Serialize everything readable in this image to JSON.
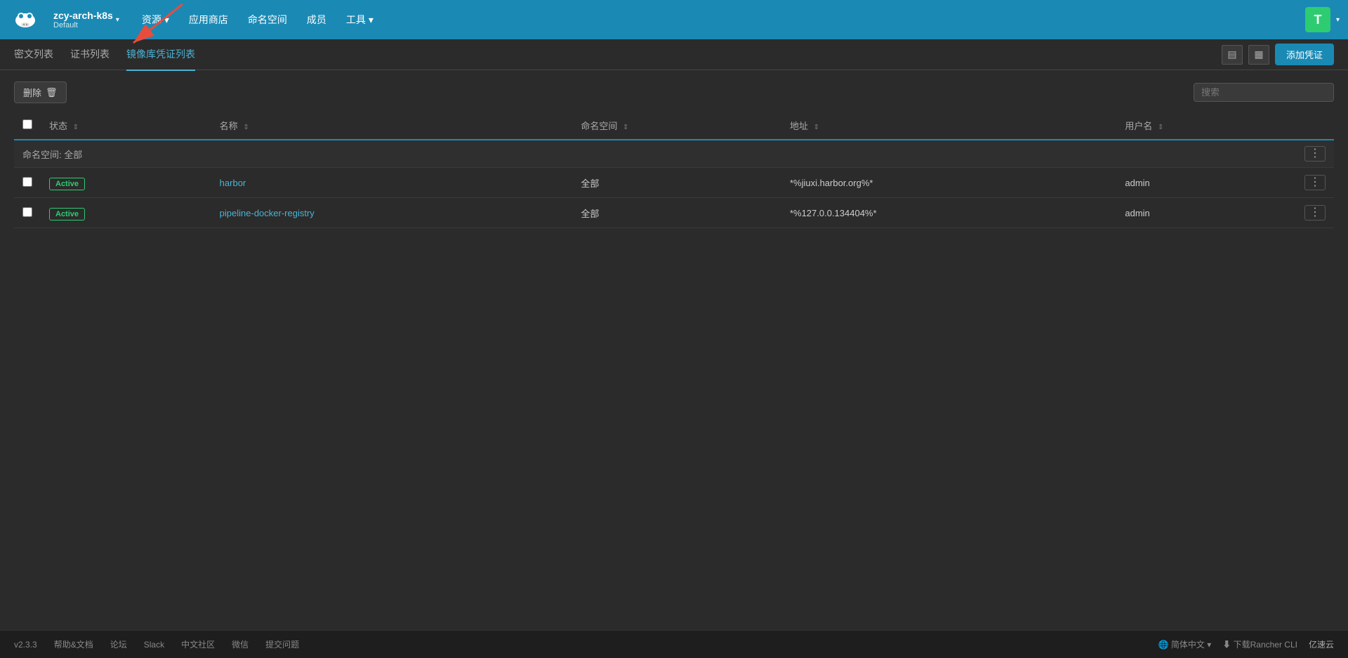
{
  "nav": {
    "cluster_name": "zcy-arch-k8s",
    "cluster_default": "Default",
    "items": [
      {
        "label": "资源▾",
        "has_dropdown": true
      },
      {
        "label": "应用商店",
        "has_dropdown": false
      },
      {
        "label": "命名空间",
        "has_dropdown": false
      },
      {
        "label": "成员",
        "has_dropdown": false
      },
      {
        "label": "工具▾",
        "has_dropdown": true
      }
    ],
    "user_avatar_text": "T"
  },
  "sub_tabs": [
    {
      "label": "密文列表",
      "active": false
    },
    {
      "label": "证书列表",
      "active": false
    },
    {
      "label": "镜像库凭证列表",
      "active": true
    }
  ],
  "toolbar": {
    "delete_label": "删除",
    "view_grid_icon": "▤",
    "view_list_icon": "▦",
    "add_btn_label": "添加凭证",
    "search_placeholder": "搜索"
  },
  "table": {
    "columns": [
      {
        "label": "状态",
        "sortable": true
      },
      {
        "label": "名称",
        "sortable": true
      },
      {
        "label": "命名空间",
        "sortable": true
      },
      {
        "label": "地址",
        "sortable": true
      },
      {
        "label": "用户名",
        "sortable": true
      }
    ],
    "group_label": "命名空间: 全部",
    "rows": [
      {
        "status": "Active",
        "name": "harbor",
        "namespace": "全部",
        "address": "*%jiuxi.harbor.org%*",
        "username": "admin"
      },
      {
        "status": "Active",
        "name": "pipeline-docker-registry",
        "namespace": "全部",
        "address": "*%127.0.0.134404%*",
        "username": "admin"
      }
    ]
  },
  "footer": {
    "version": "v2.3.3",
    "links": [
      "帮助&文档",
      "论坛",
      "Slack",
      "中文社区",
      "微信",
      "提交问题"
    ],
    "language": "简体中文",
    "download": "下载Rancher CLI"
  }
}
